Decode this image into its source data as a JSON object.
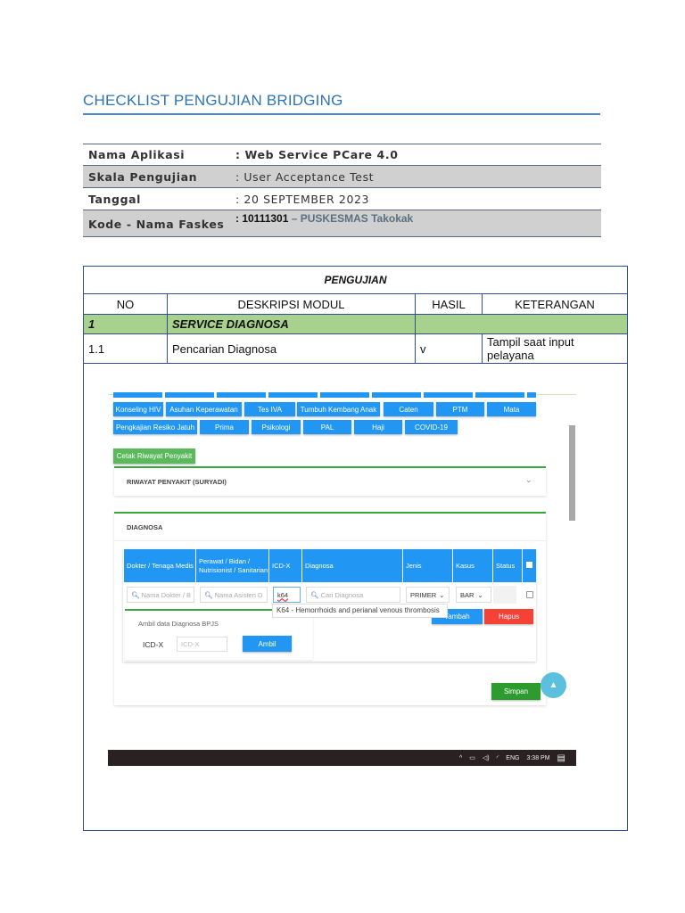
{
  "doc": {
    "title": "CHECKLIST PENGUJIAN BRIDGING",
    "info": [
      {
        "label": "Nama Aplikasi",
        "value": ": Web Service PCare 4.0"
      },
      {
        "label": "Skala Pengujian",
        "value": ": User Acceptance Test"
      },
      {
        "label": "Tanggal",
        "value": ": 20 SEPTEMBER 2023"
      },
      {
        "label": "Kode - Nama Faskes",
        "value_code": ": 10111301",
        "value_name": " – PUSKESMAS Takokak"
      }
    ]
  },
  "table": {
    "heading": "PENGUJIAN",
    "headers": [
      "NO",
      "DESKRIPSI MODUL",
      "HASIL",
      "KETERANGAN"
    ],
    "section": {
      "no": "1",
      "name": "SERVICE DIAGNOSA"
    },
    "rows": [
      {
        "no": "1.1",
        "desc": "Pencarian Diagnosa",
        "result": "v",
        "note": "Tampil saat input pelayana"
      }
    ]
  },
  "app": {
    "tabs_row1": [
      "Konseling HIV",
      "Asuhan Keperawatan",
      "Tes IVA",
      "Tumbuh Kembang Anak",
      "Caten",
      "PTM",
      "Mata"
    ],
    "tabs_row2": [
      "Pengkajian Resiko Jatuh",
      "Prima",
      "Psikologi",
      "PAL",
      "Haji",
      "COVID-19"
    ],
    "print_button": "Cetak Riwayat Penyakit",
    "history_panel": "RIWAYAT PENYAKIT (SURYADI)",
    "diagnosa_panel": "DIAGNOSA",
    "columns": [
      "Dokter / Tenaga Medis",
      "Perawat / Bidan / Nutrisionist / Sanitarian",
      "ICD-X",
      "Diagnosa",
      "Jenis",
      "Kasus",
      "Status"
    ],
    "inputs": {
      "dokter_ph": "Nama Dokter / B",
      "asisten_ph": "Nama Asisten D",
      "icd_value": "k64",
      "diagnosa_ph": "Cari Diagnosa",
      "jenis": "PRIMER",
      "kasus": "BAR"
    },
    "suggestion": "K64 - Hemorrhoids and perianal venous thrombosis",
    "add_button": "Tambah",
    "delete_button": "Hapus",
    "bpjs": {
      "title": "Ambil data Diagnosa BPJS",
      "label": "ICD-X",
      "placeholder": "ICD-X",
      "button": "Ambil"
    },
    "save_button": "Simpan",
    "taskbar": {
      "lang": "ENG",
      "time": "3:38 PM"
    }
  }
}
